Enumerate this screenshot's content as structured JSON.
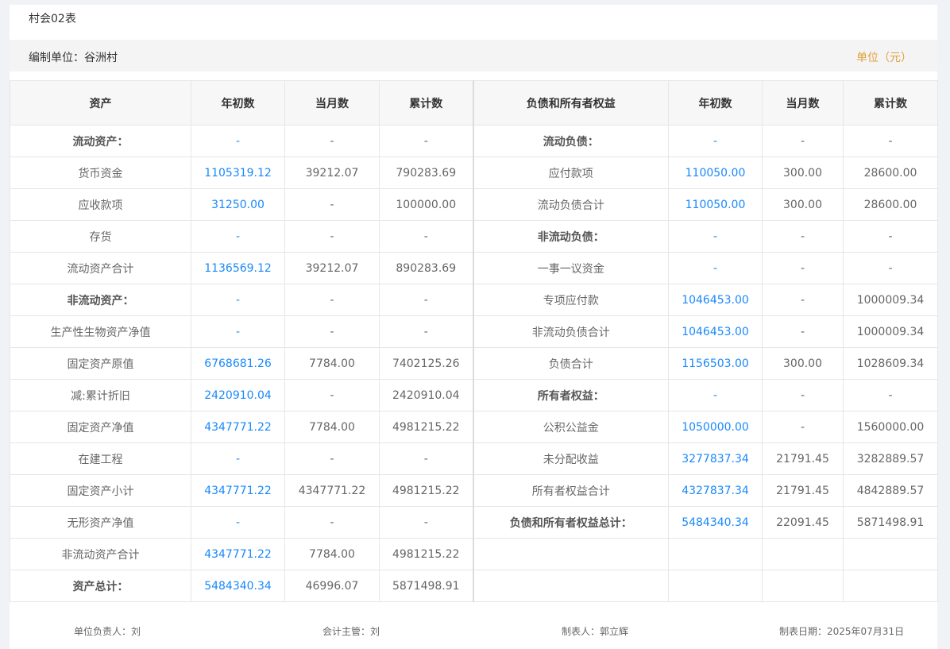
{
  "title": "村会02表",
  "org_label": "编制单位：谷洲村",
  "unit_label": "单位（元）",
  "headers": [
    "资产",
    "年初数",
    "当月数",
    "累计数",
    "负债和所有者权益",
    "年初数",
    "当月数",
    "累计数"
  ],
  "rows": [
    [
      {
        "t": "流动资产：",
        "b": 1
      },
      {
        "t": "-",
        "c": "blue"
      },
      {
        "t": "-"
      },
      {
        "t": "-"
      },
      {
        "t": "流动负债：",
        "b": 1
      },
      {
        "t": "-",
        "c": "blue"
      },
      {
        "t": "-"
      },
      {
        "t": "-"
      }
    ],
    [
      {
        "t": "货币资金"
      },
      {
        "t": "1105319.12",
        "c": "blue"
      },
      {
        "t": "39212.07"
      },
      {
        "t": "790283.69"
      },
      {
        "t": "应付款项"
      },
      {
        "t": "110050.00",
        "c": "blue"
      },
      {
        "t": "300.00"
      },
      {
        "t": "28600.00"
      }
    ],
    [
      {
        "t": "应收款项"
      },
      {
        "t": "31250.00",
        "c": "blue"
      },
      {
        "t": "-"
      },
      {
        "t": "100000.00"
      },
      {
        "t": "流动负债合计"
      },
      {
        "t": "110050.00",
        "c": "blue"
      },
      {
        "t": "300.00"
      },
      {
        "t": "28600.00"
      }
    ],
    [
      {
        "t": "存货"
      },
      {
        "t": "-",
        "c": "blue"
      },
      {
        "t": "-"
      },
      {
        "t": "-"
      },
      {
        "t": "非流动负债：",
        "b": 1
      },
      {
        "t": "-",
        "c": "blue"
      },
      {
        "t": "-"
      },
      {
        "t": "-"
      }
    ],
    [
      {
        "t": "流动资产合计"
      },
      {
        "t": "1136569.12",
        "c": "blue"
      },
      {
        "t": "39212.07"
      },
      {
        "t": "890283.69"
      },
      {
        "t": "一事一议资金"
      },
      {
        "t": "-",
        "c": "blue"
      },
      {
        "t": "-"
      },
      {
        "t": "-"
      }
    ],
    [
      {
        "t": "非流动资产：",
        "b": 1
      },
      {
        "t": "-",
        "c": "blue"
      },
      {
        "t": "-"
      },
      {
        "t": "-"
      },
      {
        "t": "专项应付款"
      },
      {
        "t": "1046453.00",
        "c": "blue"
      },
      {
        "t": "-"
      },
      {
        "t": "1000009.34"
      }
    ],
    [
      {
        "t": "生产性生物资产净值"
      },
      {
        "t": "-",
        "c": "blue"
      },
      {
        "t": "-"
      },
      {
        "t": "-"
      },
      {
        "t": "非流动负债合计"
      },
      {
        "t": "1046453.00",
        "c": "blue"
      },
      {
        "t": "-"
      },
      {
        "t": "1000009.34"
      }
    ],
    [
      {
        "t": "固定资产原值"
      },
      {
        "t": "6768681.26",
        "c": "blue"
      },
      {
        "t": "7784.00"
      },
      {
        "t": "7402125.26"
      },
      {
        "t": "负债合计"
      },
      {
        "t": "1156503.00",
        "c": "blue"
      },
      {
        "t": "300.00"
      },
      {
        "t": "1028609.34"
      }
    ],
    [
      {
        "t": "减:累计折旧"
      },
      {
        "t": "2420910.04",
        "c": "blue"
      },
      {
        "t": "-"
      },
      {
        "t": "2420910.04"
      },
      {
        "t": "所有者权益：",
        "b": 1
      },
      {
        "t": "-",
        "c": "blue"
      },
      {
        "t": "-"
      },
      {
        "t": "-"
      }
    ],
    [
      {
        "t": "固定资产净值"
      },
      {
        "t": "4347771.22",
        "c": "blue"
      },
      {
        "t": "7784.00"
      },
      {
        "t": "4981215.22"
      },
      {
        "t": "公积公益金"
      },
      {
        "t": "1050000.00",
        "c": "blue"
      },
      {
        "t": "-"
      },
      {
        "t": "1560000.00"
      }
    ],
    [
      {
        "t": "在建工程"
      },
      {
        "t": "-",
        "c": "blue"
      },
      {
        "t": "-"
      },
      {
        "t": "-"
      },
      {
        "t": "未分配收益"
      },
      {
        "t": "3277837.34",
        "c": "blue"
      },
      {
        "t": "21791.45"
      },
      {
        "t": "3282889.57"
      }
    ],
    [
      {
        "t": "固定资产小计"
      },
      {
        "t": "4347771.22",
        "c": "blue"
      },
      {
        "t": "4347771.22"
      },
      {
        "t": "4981215.22"
      },
      {
        "t": "所有者权益合计"
      },
      {
        "t": "4327837.34",
        "c": "blue"
      },
      {
        "t": "21791.45"
      },
      {
        "t": "4842889.57"
      }
    ],
    [
      {
        "t": "无形资产净值"
      },
      {
        "t": "-",
        "c": "blue"
      },
      {
        "t": "-"
      },
      {
        "t": "-"
      },
      {
        "t": "负债和所有者权益总计：",
        "b": 1
      },
      {
        "t": "5484340.34",
        "c": "blue"
      },
      {
        "t": "22091.45"
      },
      {
        "t": "5871498.91"
      }
    ],
    [
      {
        "t": "非流动资产合计"
      },
      {
        "t": "4347771.22",
        "c": "blue"
      },
      {
        "t": "7784.00"
      },
      {
        "t": "4981215.22"
      },
      {
        "t": ""
      },
      {
        "t": ""
      },
      {
        "t": ""
      },
      {
        "t": ""
      }
    ],
    [
      {
        "t": "资产总计：",
        "b": 1
      },
      {
        "t": "5484340.34",
        "c": "blue"
      },
      {
        "t": "46996.07"
      },
      {
        "t": "5871498.91"
      },
      {
        "t": ""
      },
      {
        "t": ""
      },
      {
        "t": ""
      },
      {
        "t": ""
      }
    ]
  ],
  "footer": {
    "unit_head": "单位负责人：刘",
    "accounting_head": "会计主管：刘",
    "preparer": "制表人：郭立辉",
    "date": "制表日期：2025年07月31日"
  },
  "colors": {
    "link": "#1989fa",
    "unit": "#e0a13c",
    "header_bg": "#f7f7f7"
  }
}
